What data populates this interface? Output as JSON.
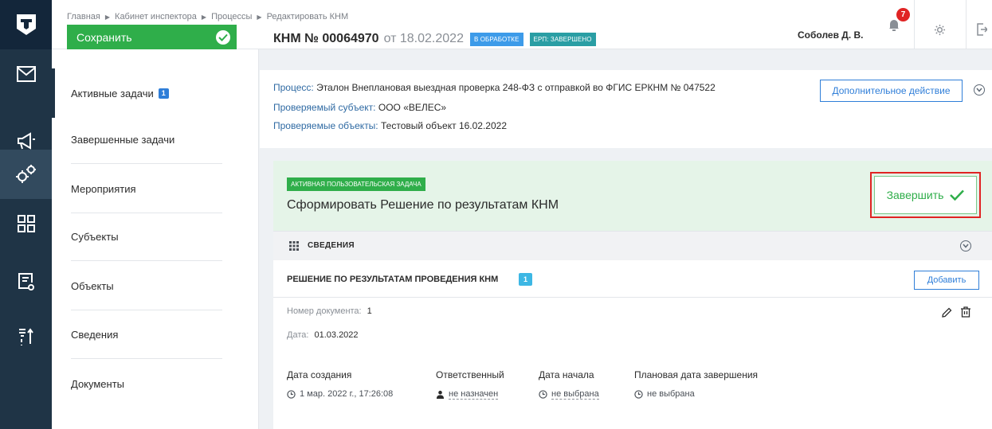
{
  "header": {
    "breadcrumbs": [
      "Главная",
      "Кабинет инспектора",
      "Процессы",
      "Редактировать КНМ"
    ],
    "save_label": "Сохранить",
    "doc_number": "КНМ № 00064970",
    "doc_date": "от 18.02.2022",
    "status_badge": "В ОБРАБОТКЕ",
    "erp_badge": "ЕРП: ЗАВЕРШЕНО",
    "user_name": "Соболев Д. В.",
    "notifications_count": "7"
  },
  "sidebar": {
    "items": [
      {
        "label": "Активные задачи",
        "count": "1"
      },
      {
        "label": "Завершенные задачи"
      },
      {
        "label": "Мероприятия"
      },
      {
        "label": "Субъекты"
      },
      {
        "label": "Объекты"
      },
      {
        "label": "Сведения"
      },
      {
        "label": "Документы"
      }
    ]
  },
  "process_info": {
    "process_label": "Процесс:",
    "process_value": "Эталон Внеплановая выездная проверка 248-ФЗ с отправкой во ФГИС ЕРКНМ № 047522",
    "subject_label": "Проверяемый субъект:",
    "subject_value": "ООО «ВЕЛЕС»",
    "objects_label": "Проверяемые объекты:",
    "objects_value": "Тестовый объект 16.02.2022",
    "extra_action_label": "Дополнительное действие"
  },
  "task": {
    "badge": "АКТИВНАЯ ПОЛЬЗОВАТЕЛЬСКАЯ ЗАДАЧА",
    "title": "Сформировать Решение по результатам КНМ",
    "finish_label": "Завершить"
  },
  "details_bar": {
    "label": "СВЕДЕНИЯ"
  },
  "decision": {
    "title": "РЕШЕНИЕ ПО РЕЗУЛЬТАТАМ ПРОВЕДЕНИЯ КНМ",
    "count": "1",
    "add_label": "Добавить",
    "doc_number_label": "Номер документа:",
    "doc_number_value": "1",
    "date_label": "Дата:",
    "date_value": "01.03.2022",
    "created_label": "Дата создания",
    "created_value": "1 мар. 2022 г., 17:26:08",
    "responsible_label": "Ответственный",
    "responsible_value": "не назначен",
    "start_label": "Дата начала",
    "start_value": "не выбрана",
    "planned_end_label": "Плановая дата завершения",
    "planned_end_value": "не выбрана"
  },
  "colors": {
    "rail": "#1f3446",
    "save_green": "#2fae4a",
    "accent_blue": "#2f7ed8",
    "task_bg": "#e5f4e8",
    "highlight_red": "#e02424"
  }
}
